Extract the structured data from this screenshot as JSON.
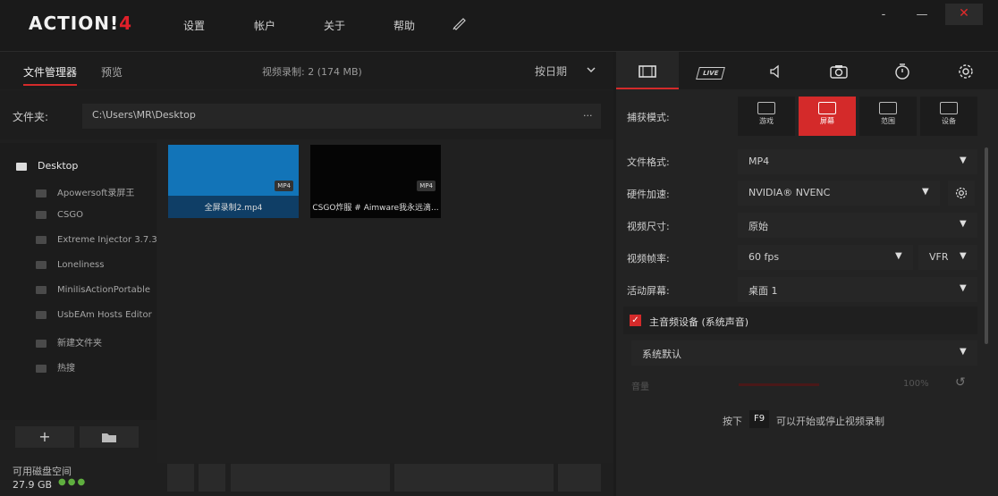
{
  "app": {
    "logo_main": "ACTION!",
    "logo_num": "4"
  },
  "menu": {
    "settings": "设置",
    "account": "帐户",
    "about": "关于",
    "help": "帮助"
  },
  "window": {
    "minimize": "-",
    "maximize": "—",
    "close": "✕"
  },
  "left": {
    "tabs": {
      "files": "文件管理器",
      "preview": "预览"
    },
    "recording_info": "视频录制: 2 (174 MB)",
    "sort": "按日期",
    "folder_label": "文件夹:",
    "folder_path": "C:\\Users\\MR\\Desktop",
    "folder_more": "...",
    "tree": {
      "root": "Desktop",
      "items": [
        "Apowersoft录屏王",
        "CSGO",
        "Extreme Injector 3.7.3",
        "Loneliness",
        "MiniIisActionPortable",
        "UsbEAm Hosts Editor",
        "新建文件夹",
        "热搜"
      ]
    },
    "files": [
      {
        "name": "全屏录制2.mp4",
        "badge": "MP4"
      },
      {
        "name": "CSGO炸服 # Aimware我永远滴...",
        "badge": "MP4"
      }
    ],
    "add_label": "+",
    "disk_label": "可用磁盘空间",
    "disk_value": "27.9 GB"
  },
  "right": {
    "capture_mode_label": "捕获模式:",
    "modes": {
      "game": "游戏",
      "screen": "屏幕",
      "region": "范围",
      "device": "设备"
    },
    "format_label": "文件格式:",
    "format_value": "MP4",
    "hw_label": "硬件加速:",
    "hw_value": "NVIDIA® NVENC",
    "size_label": "视频尺寸:",
    "size_value": "原始",
    "fps_label": "视频帧率:",
    "fps_value": "60 fps",
    "vfr_value": "VFR",
    "screen_label": "活动屏幕:",
    "screen_value": "桌面 1",
    "audio_label": "主音频设备 (系统声音)",
    "audio_device": "系统默认",
    "volume_label": "音量",
    "volume_value": "100%",
    "hotkey_pre": "按下",
    "hotkey_key": "F9",
    "hotkey_post": "可以开始或停止视频录制"
  }
}
